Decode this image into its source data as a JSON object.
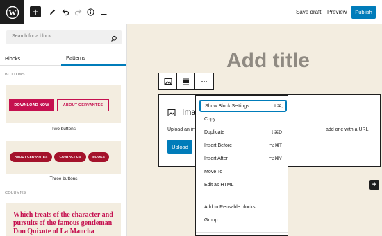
{
  "toolbar": {
    "save_draft": "Save draft",
    "preview": "Preview",
    "publish": "Publish"
  },
  "inserter": {
    "search_placeholder": "Search for a block",
    "tabs": [
      "Blocks",
      "Patterns"
    ],
    "sections": {
      "buttons": "BUTTONS",
      "columns": "COLUMNS"
    },
    "pattern_two_buttons": {
      "btn1": "DOWNLOAD NOW",
      "btn2": "ABOUT CERVANTES",
      "caption": "Two buttons"
    },
    "pattern_three_buttons": {
      "btn1": "ABOUT CERVANTES",
      "btn2": "CONTACT US",
      "btn3": "BOOKS",
      "caption": "Three buttons"
    },
    "columns_preview_text": "Which treats of the character and pursuits of the famous gentleman Don Quixote of La Mancha"
  },
  "editor": {
    "title": "Add title",
    "image_block_title": "Ima",
    "image_block_desc": "Upload an im",
    "image_block_desc_end": "add one with a URL.",
    "upload_label": "Upload"
  },
  "menu": {
    "items": [
      {
        "label": "Show Block Settings",
        "shortcut": "⇧⌘,"
      },
      {
        "label": "Copy",
        "shortcut": ""
      },
      {
        "label": "Duplicate",
        "shortcut": "⇧⌘D"
      },
      {
        "label": "Insert Before",
        "shortcut": "⌥⌘T"
      },
      {
        "label": "Insert After",
        "shortcut": "⌥⌘Y"
      },
      {
        "label": "Move To",
        "shortcut": ""
      },
      {
        "label": "Edit as HTML",
        "shortcut": ""
      },
      {
        "label": "Add to Reusable blocks",
        "shortcut": ""
      },
      {
        "label": "Group",
        "shortcut": ""
      }
    ]
  },
  "colors": {
    "accent": "#007cba",
    "pattern_red": "#c5104f",
    "canvas_bg": "#f3ede0"
  }
}
